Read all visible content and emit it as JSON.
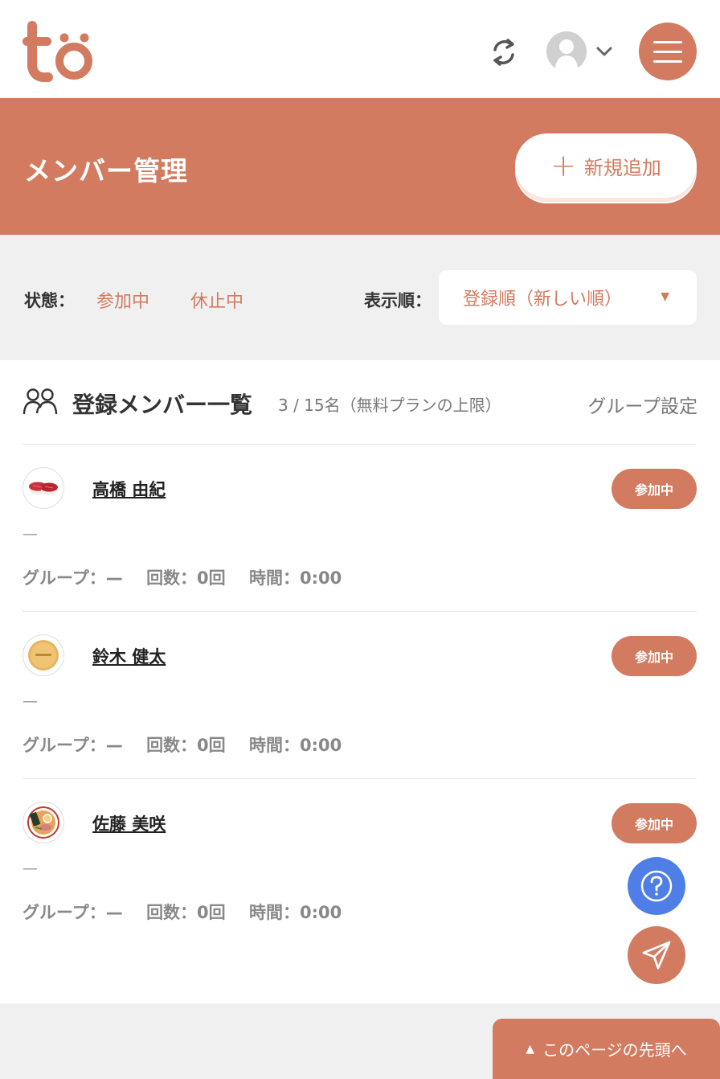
{
  "header": {
    "logo_text": "to",
    "accent_color": "#d27b60"
  },
  "hero": {
    "title": "メンバー管理",
    "add_button_label": "新規追加"
  },
  "filter": {
    "status_label": "状態：",
    "status_options": [
      "参加中",
      "休止中"
    ],
    "sort_label": "表示順：",
    "sort_selected": "登録順（新しい順）"
  },
  "list": {
    "title": "登録メンバー一覧",
    "count_text": "3 / 15名（無料プランの上限）",
    "group_settings_label": "グループ設定",
    "members": [
      {
        "name": "高橋 由紀",
        "status": "参加中",
        "note": "—",
        "group": "グループ：—",
        "count": "回数：0回",
        "time": "時間：0:00",
        "avatar": "sushi"
      },
      {
        "name": "鈴木 健太",
        "status": "参加中",
        "note": "—",
        "group": "グループ：—",
        "count": "回数：0回",
        "time": "時間：0:00",
        "avatar": "cookie"
      },
      {
        "name": "佐藤 美咲",
        "status": "参加中",
        "note": "—",
        "group": "グループ：—",
        "count": "回数：0回",
        "time": "時間：0:00",
        "avatar": "ramen"
      }
    ]
  },
  "fab": {
    "help_icon": "question-icon",
    "send_icon": "paper-plane-icon"
  },
  "to_top_label": "このページの先頭へ"
}
